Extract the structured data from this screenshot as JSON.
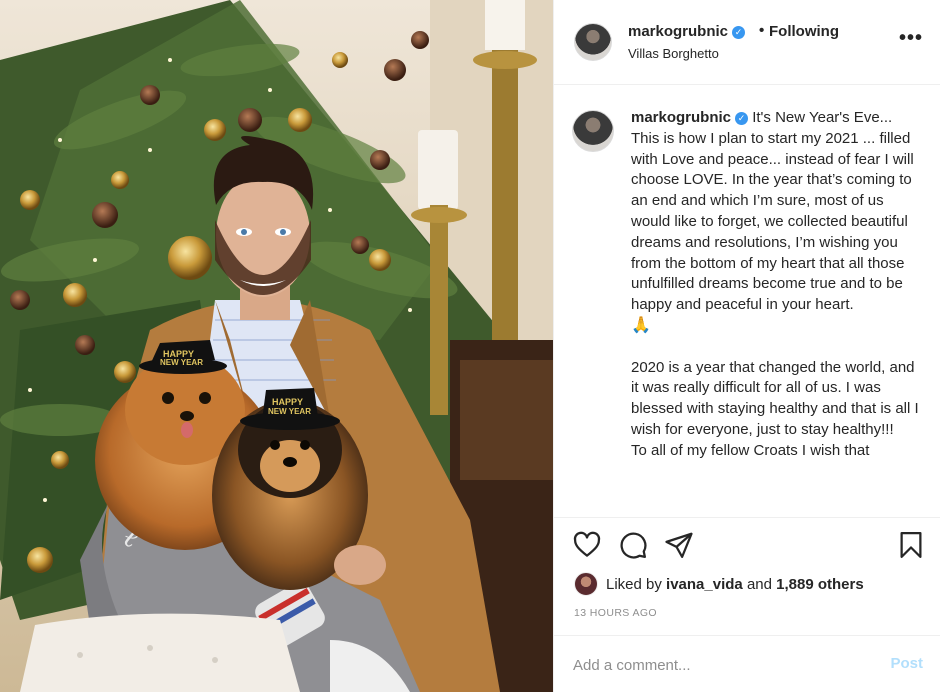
{
  "post": {
    "photo_icon": "christmas-portrait-photo",
    "badge_text": "HAPPY NEW YEAR"
  },
  "header": {
    "username": "markogrubnic",
    "verified_icon": "verified-badge-icon",
    "separator": "•",
    "follow_status": "Following",
    "location": "Villas Borghetto",
    "more_icon": "more-options-icon",
    "more_label": "•••"
  },
  "caption": {
    "username": "markogrubnic",
    "paragraph1": "It's New Year's Eve... This is how I plan to start my 2021 ... filled with Love and peace... instead of fear I will choose LOVE. In the year that’s coming to an end and which I’m sure, most of us would like to forget, we collected beautiful dreams and resolutions, I’m wishing you from the bottom of my heart that all those unfulfilled dreams become true and to be happy and peaceful in your heart.",
    "emoji": "🙏",
    "paragraph2": "2020 is a year that changed the world, and it was really difficult for all of us. I was blessed with staying healthy and that is all I wish for everyone, just to stay healthy!!!",
    "paragraph3": "To all of my fellow Croats I wish that"
  },
  "actions": {
    "like_icon": "heart-icon",
    "comment_icon": "comment-icon",
    "share_icon": "share-icon",
    "save_icon": "bookmark-icon"
  },
  "likes": {
    "prefix": "Liked by ",
    "user": "ivana_vida",
    "middle": " and ",
    "count": "1,889 others"
  },
  "timestamp": "13 HOURS AGO",
  "comment": {
    "placeholder": "Add a comment...",
    "post_label": "Post"
  },
  "colors": {
    "verified": "#3897f0",
    "post_disabled": "#b2dffc",
    "muted": "#8e8e8e",
    "text": "#262626"
  }
}
